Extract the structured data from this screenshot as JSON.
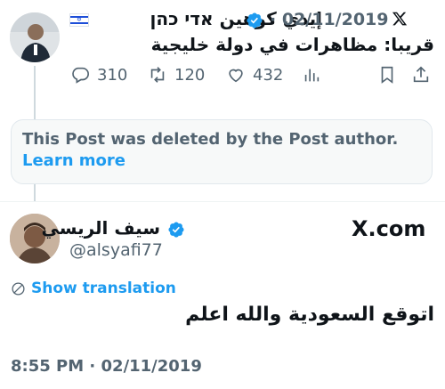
{
  "tweet1": {
    "name": "إيدي كوهين אדי כהן",
    "date": "02/11/2019",
    "date_separator": "·",
    "flag_label": "Israel flag",
    "text": "قريبا: مظاهرات في دولة خليجية",
    "actions": {
      "replies": "310",
      "retweets": "120",
      "likes": "432"
    }
  },
  "deleted_notice": {
    "text": "This Post was deleted by the Post author.",
    "link": "Learn more"
  },
  "tweet2": {
    "name": "سيف الريسي",
    "handle": "@alsyafi77",
    "platform": "X.com",
    "translate_label": "Show translation",
    "text": "اتوقع السعودية والله اعلم",
    "timestamp": "8:55 PM · 02/11/2019"
  },
  "colors": {
    "accent": "#1d9bf0",
    "muted": "#536471",
    "text": "#0f1419"
  }
}
